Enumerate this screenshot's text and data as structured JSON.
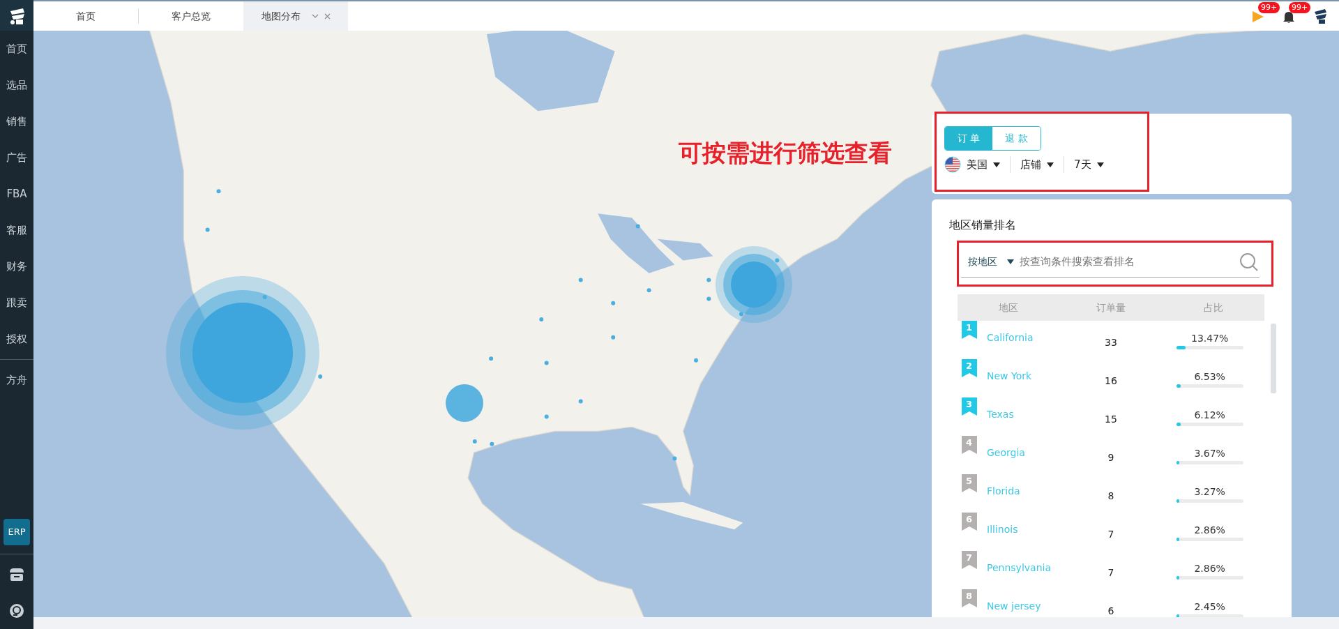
{
  "tabs": [
    {
      "label": "首页",
      "selected": false
    },
    {
      "label": "客户总览",
      "selected": false
    },
    {
      "label": "地图分布",
      "selected": true
    }
  ],
  "notifications": [
    {
      "kind": "flag",
      "badge": "99+"
    },
    {
      "kind": "bell",
      "badge": "99+"
    }
  ],
  "sidebar": {
    "items": [
      {
        "label": "首页"
      },
      {
        "label": "选品"
      },
      {
        "label": "销售"
      },
      {
        "label": "广告"
      },
      {
        "label": "FBA"
      },
      {
        "label": "客服"
      },
      {
        "label": "财务"
      },
      {
        "label": "跟卖"
      },
      {
        "label": "授权"
      }
    ],
    "secondary": [
      {
        "label": "方舟"
      }
    ],
    "erp": "ERP"
  },
  "filter_panel": {
    "type_toggle": [
      {
        "label": "订 单",
        "selected": true
      },
      {
        "label": "退 款",
        "selected": false
      }
    ],
    "dropdowns": [
      {
        "label": "美国",
        "kind": "country"
      },
      {
        "label": "店铺",
        "kind": "plain"
      },
      {
        "label": "7天",
        "kind": "plain"
      }
    ]
  },
  "annotation": "可按需进行筛选查看",
  "ranking": {
    "title": "地区销量排名",
    "search": {
      "scope": "按地区",
      "placeholder": "按查询条件搜索查看排名"
    },
    "columns": [
      "地区",
      "订单量",
      "占比"
    ],
    "rows": [
      {
        "rank": "1",
        "highlighted": true,
        "region": "California",
        "orders": "33",
        "share": "13.47%",
        "level": 0.1347
      },
      {
        "rank": "2",
        "highlighted": true,
        "region": "New York",
        "orders": "16",
        "share": "6.53%",
        "level": 0.0653
      },
      {
        "rank": "3",
        "highlighted": true,
        "region": "Texas",
        "orders": "15",
        "share": "6.12%",
        "level": 0.0612
      },
      {
        "rank": "4",
        "highlighted": false,
        "region": "Georgia",
        "orders": "9",
        "share": "3.67%",
        "level": 0.0367
      },
      {
        "rank": "5",
        "highlighted": false,
        "region": "Florida",
        "orders": "8",
        "share": "3.27%",
        "level": 0.0327
      },
      {
        "rank": "6",
        "highlighted": false,
        "region": "Illinois",
        "orders": "7",
        "share": "2.86%",
        "level": 0.0286
      },
      {
        "rank": "7",
        "highlighted": false,
        "region": "Pennsylvania",
        "orders": "7",
        "share": "2.86%",
        "level": 0.0286
      },
      {
        "rank": "8",
        "highlighted": false,
        "region": "New jersey",
        "orders": "6",
        "share": "2.45%",
        "level": 0.0245
      }
    ]
  }
}
